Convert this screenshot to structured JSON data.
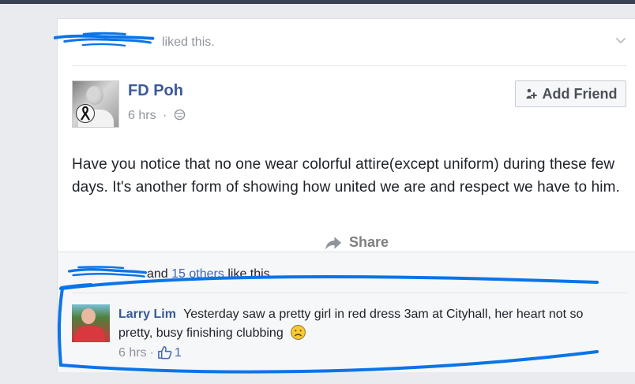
{
  "feed": {
    "liked_by": {
      "suffix_text": "liked this."
    },
    "post": {
      "author_name": "FD Poh",
      "time_text": "6 hrs",
      "meta_separator": "·",
      "add_friend_label": "Add Friend",
      "body_text": "Have you notice that no one wear colorful attire(except uniform) during these few days. It's another form of showing how united we are and respect we have to him.",
      "share_label": "Share"
    },
    "likes": {
      "prefix_text": "and",
      "others_text": "15 others",
      "suffix_text": "like this."
    },
    "comment": {
      "author_name": "Larry Lim",
      "text": "Yesterday saw a pretty girl in red dress 3am at Cityhall, her heart not so pretty, busy finishing clubbing",
      "time_text": "6 hrs",
      "meta_separator": "·",
      "like_count": "1"
    }
  },
  "icons": {
    "chevron": "chevron-down-icon",
    "add_friend": "add-friend-icon",
    "globe": "globe-icon",
    "share": "share-icon",
    "emoji": "sad-face-icon",
    "like": "thumbs-up-icon",
    "scribble": "scribble-overlay"
  },
  "colors": {
    "background": "#e9ebee",
    "card": "#ffffff",
    "name_blue": "#3b5998",
    "link_blue": "#4267b2",
    "meta_gray": "#90949c",
    "text": "#1d2129",
    "annotation_blue": "#0a74e8"
  }
}
